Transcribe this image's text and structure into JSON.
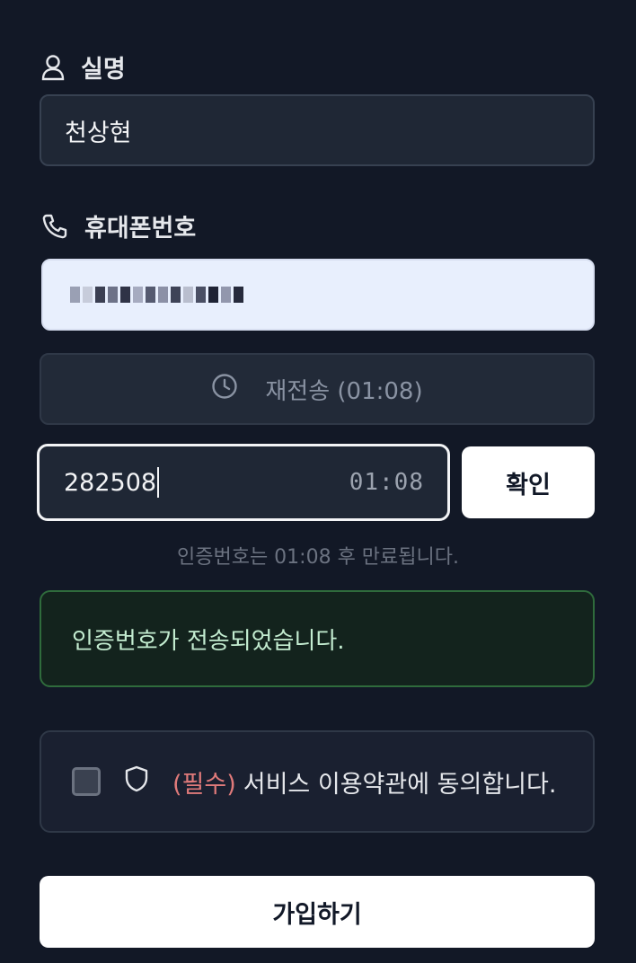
{
  "name_section": {
    "label": "실명",
    "icon": "user-icon",
    "value": "천상현"
  },
  "phone_section": {
    "label": "휴대폰번호",
    "icon": "phone-icon",
    "value_masked": true
  },
  "resend": {
    "label": "재전송 (01:08)",
    "icon": "clock-icon"
  },
  "verification": {
    "code_value": "282508",
    "timer": "01:08",
    "confirm_label": "확인",
    "expire_note": "인증번호는 01:08 후 만료됩니다."
  },
  "success_message": "인증번호가 전송되었습니다.",
  "terms": {
    "required_tag": "(필수)",
    "text": "서비스 이용약관에 동의합니다.",
    "checked": false,
    "icon": "shield-icon"
  },
  "signup_label": "가입하기",
  "colors": {
    "background": "#121826",
    "success_border": "#2f6b3c",
    "required_red": "#e07a7a"
  }
}
